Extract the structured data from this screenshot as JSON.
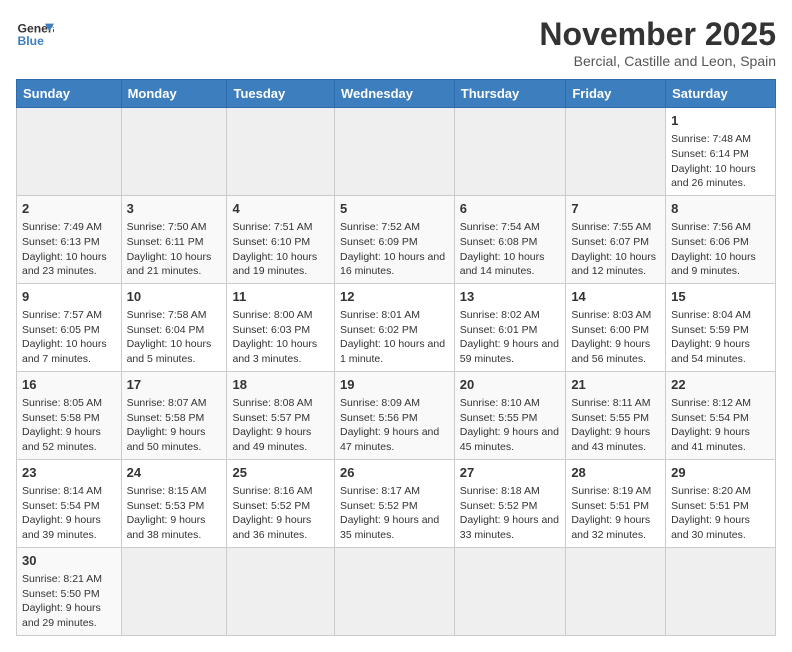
{
  "header": {
    "logo_line1": "General",
    "logo_line2": "Blue",
    "month": "November 2025",
    "location": "Bercial, Castille and Leon, Spain"
  },
  "days_of_week": [
    "Sunday",
    "Monday",
    "Tuesday",
    "Wednesday",
    "Thursday",
    "Friday",
    "Saturday"
  ],
  "weeks": [
    [
      {
        "day": "",
        "info": "",
        "empty": true
      },
      {
        "day": "",
        "info": "",
        "empty": true
      },
      {
        "day": "",
        "info": "",
        "empty": true
      },
      {
        "day": "",
        "info": "",
        "empty": true
      },
      {
        "day": "",
        "info": "",
        "empty": true
      },
      {
        "day": "",
        "info": "",
        "empty": true
      },
      {
        "day": "1",
        "info": "Sunrise: 7:48 AM\nSunset: 6:14 PM\nDaylight: 10 hours and 26 minutes.",
        "empty": false
      }
    ],
    [
      {
        "day": "2",
        "info": "Sunrise: 7:49 AM\nSunset: 6:13 PM\nDaylight: 10 hours and 23 minutes.",
        "empty": false
      },
      {
        "day": "3",
        "info": "Sunrise: 7:50 AM\nSunset: 6:11 PM\nDaylight: 10 hours and 21 minutes.",
        "empty": false
      },
      {
        "day": "4",
        "info": "Sunrise: 7:51 AM\nSunset: 6:10 PM\nDaylight: 10 hours and 19 minutes.",
        "empty": false
      },
      {
        "day": "5",
        "info": "Sunrise: 7:52 AM\nSunset: 6:09 PM\nDaylight: 10 hours and 16 minutes.",
        "empty": false
      },
      {
        "day": "6",
        "info": "Sunrise: 7:54 AM\nSunset: 6:08 PM\nDaylight: 10 hours and 14 minutes.",
        "empty": false
      },
      {
        "day": "7",
        "info": "Sunrise: 7:55 AM\nSunset: 6:07 PM\nDaylight: 10 hours and 12 minutes.",
        "empty": false
      },
      {
        "day": "8",
        "info": "Sunrise: 7:56 AM\nSunset: 6:06 PM\nDaylight: 10 hours and 9 minutes.",
        "empty": false
      }
    ],
    [
      {
        "day": "9",
        "info": "Sunrise: 7:57 AM\nSunset: 6:05 PM\nDaylight: 10 hours and 7 minutes.",
        "empty": false
      },
      {
        "day": "10",
        "info": "Sunrise: 7:58 AM\nSunset: 6:04 PM\nDaylight: 10 hours and 5 minutes.",
        "empty": false
      },
      {
        "day": "11",
        "info": "Sunrise: 8:00 AM\nSunset: 6:03 PM\nDaylight: 10 hours and 3 minutes.",
        "empty": false
      },
      {
        "day": "12",
        "info": "Sunrise: 8:01 AM\nSunset: 6:02 PM\nDaylight: 10 hours and 1 minute.",
        "empty": false
      },
      {
        "day": "13",
        "info": "Sunrise: 8:02 AM\nSunset: 6:01 PM\nDaylight: 9 hours and 59 minutes.",
        "empty": false
      },
      {
        "day": "14",
        "info": "Sunrise: 8:03 AM\nSunset: 6:00 PM\nDaylight: 9 hours and 56 minutes.",
        "empty": false
      },
      {
        "day": "15",
        "info": "Sunrise: 8:04 AM\nSunset: 5:59 PM\nDaylight: 9 hours and 54 minutes.",
        "empty": false
      }
    ],
    [
      {
        "day": "16",
        "info": "Sunrise: 8:05 AM\nSunset: 5:58 PM\nDaylight: 9 hours and 52 minutes.",
        "empty": false
      },
      {
        "day": "17",
        "info": "Sunrise: 8:07 AM\nSunset: 5:58 PM\nDaylight: 9 hours and 50 minutes.",
        "empty": false
      },
      {
        "day": "18",
        "info": "Sunrise: 8:08 AM\nSunset: 5:57 PM\nDaylight: 9 hours and 49 minutes.",
        "empty": false
      },
      {
        "day": "19",
        "info": "Sunrise: 8:09 AM\nSunset: 5:56 PM\nDaylight: 9 hours and 47 minutes.",
        "empty": false
      },
      {
        "day": "20",
        "info": "Sunrise: 8:10 AM\nSunset: 5:55 PM\nDaylight: 9 hours and 45 minutes.",
        "empty": false
      },
      {
        "day": "21",
        "info": "Sunrise: 8:11 AM\nSunset: 5:55 PM\nDaylight: 9 hours and 43 minutes.",
        "empty": false
      },
      {
        "day": "22",
        "info": "Sunrise: 8:12 AM\nSunset: 5:54 PM\nDaylight: 9 hours and 41 minutes.",
        "empty": false
      }
    ],
    [
      {
        "day": "23",
        "info": "Sunrise: 8:14 AM\nSunset: 5:54 PM\nDaylight: 9 hours and 39 minutes.",
        "empty": false
      },
      {
        "day": "24",
        "info": "Sunrise: 8:15 AM\nSunset: 5:53 PM\nDaylight: 9 hours and 38 minutes.",
        "empty": false
      },
      {
        "day": "25",
        "info": "Sunrise: 8:16 AM\nSunset: 5:52 PM\nDaylight: 9 hours and 36 minutes.",
        "empty": false
      },
      {
        "day": "26",
        "info": "Sunrise: 8:17 AM\nSunset: 5:52 PM\nDaylight: 9 hours and 35 minutes.",
        "empty": false
      },
      {
        "day": "27",
        "info": "Sunrise: 8:18 AM\nSunset: 5:52 PM\nDaylight: 9 hours and 33 minutes.",
        "empty": false
      },
      {
        "day": "28",
        "info": "Sunrise: 8:19 AM\nSunset: 5:51 PM\nDaylight: 9 hours and 32 minutes.",
        "empty": false
      },
      {
        "day": "29",
        "info": "Sunrise: 8:20 AM\nSunset: 5:51 PM\nDaylight: 9 hours and 30 minutes.",
        "empty": false
      }
    ],
    [
      {
        "day": "30",
        "info": "Sunrise: 8:21 AM\nSunset: 5:50 PM\nDaylight: 9 hours and 29 minutes.",
        "empty": false
      },
      {
        "day": "",
        "info": "",
        "empty": true
      },
      {
        "day": "",
        "info": "",
        "empty": true
      },
      {
        "day": "",
        "info": "",
        "empty": true
      },
      {
        "day": "",
        "info": "",
        "empty": true
      },
      {
        "day": "",
        "info": "",
        "empty": true
      },
      {
        "day": "",
        "info": "",
        "empty": true
      }
    ]
  ]
}
